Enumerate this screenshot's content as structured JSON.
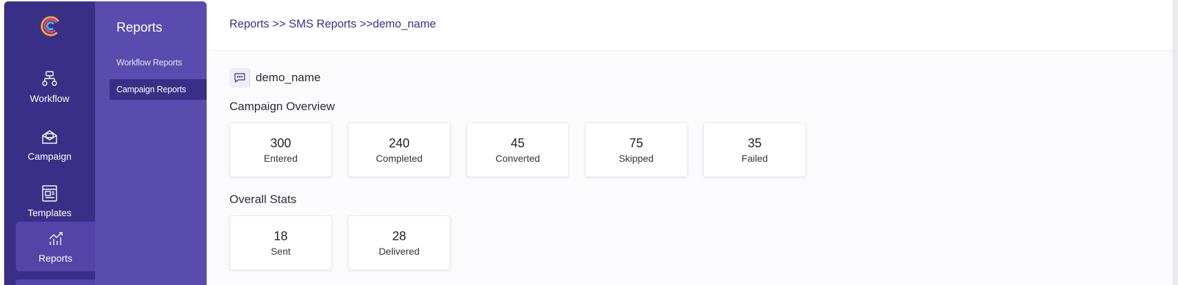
{
  "nav": {
    "items": [
      {
        "label": "Workflow",
        "icon": "workflow-icon"
      },
      {
        "label": "Campaign",
        "icon": "campaign-icon"
      },
      {
        "label": "Templates",
        "icon": "templates-icon"
      },
      {
        "label": "Reports",
        "icon": "reports-icon"
      }
    ]
  },
  "subnav": {
    "title": "Reports",
    "items": [
      {
        "label": "Workflow Reports"
      },
      {
        "label": "Campaign Reports"
      }
    ]
  },
  "breadcrumb": "Reports >> SMS Reports >>demo_name",
  "campaign": {
    "name": "demo_name"
  },
  "overview": {
    "title": "Campaign Overview",
    "cards": [
      {
        "value": "300",
        "label": "Entered"
      },
      {
        "value": "240",
        "label": "Completed"
      },
      {
        "value": "45",
        "label": "Converted"
      },
      {
        "value": "75",
        "label": "Skipped"
      },
      {
        "value": "35",
        "label": "Failed"
      }
    ]
  },
  "stats": {
    "title": "Overall Stats",
    "cards": [
      {
        "value": "18",
        "label": "Sent"
      },
      {
        "value": "28",
        "label": "Delivered"
      }
    ]
  },
  "colors": {
    "rail": "#3a2f86",
    "subnav": "#5a4cad",
    "active": "#5444a8",
    "accent_text": "#3a2f86"
  }
}
